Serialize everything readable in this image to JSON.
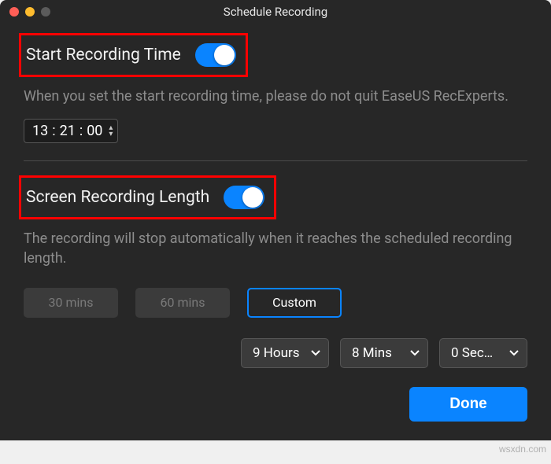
{
  "window": {
    "title": "Schedule Recording"
  },
  "start": {
    "label": "Start Recording Time",
    "toggle_on": true,
    "hint": "When you set the start recording time, please do not quit EaseUS RecExperts.",
    "time": {
      "hh": "13",
      "mm": "21",
      "ss": "00"
    }
  },
  "length": {
    "label": "Screen Recording Length",
    "toggle_on": true,
    "hint": "The recording will stop automatically when it reaches the scheduled recording length.",
    "presets": {
      "p30": "30 mins",
      "p60": "60 mins",
      "custom": "Custom",
      "selected": "custom"
    },
    "custom": {
      "hours": "9 Hours",
      "mins": "8 Mins",
      "secs": "0 Sec…"
    }
  },
  "footer": {
    "done": "Done"
  },
  "watermark": "wsxdn.com"
}
